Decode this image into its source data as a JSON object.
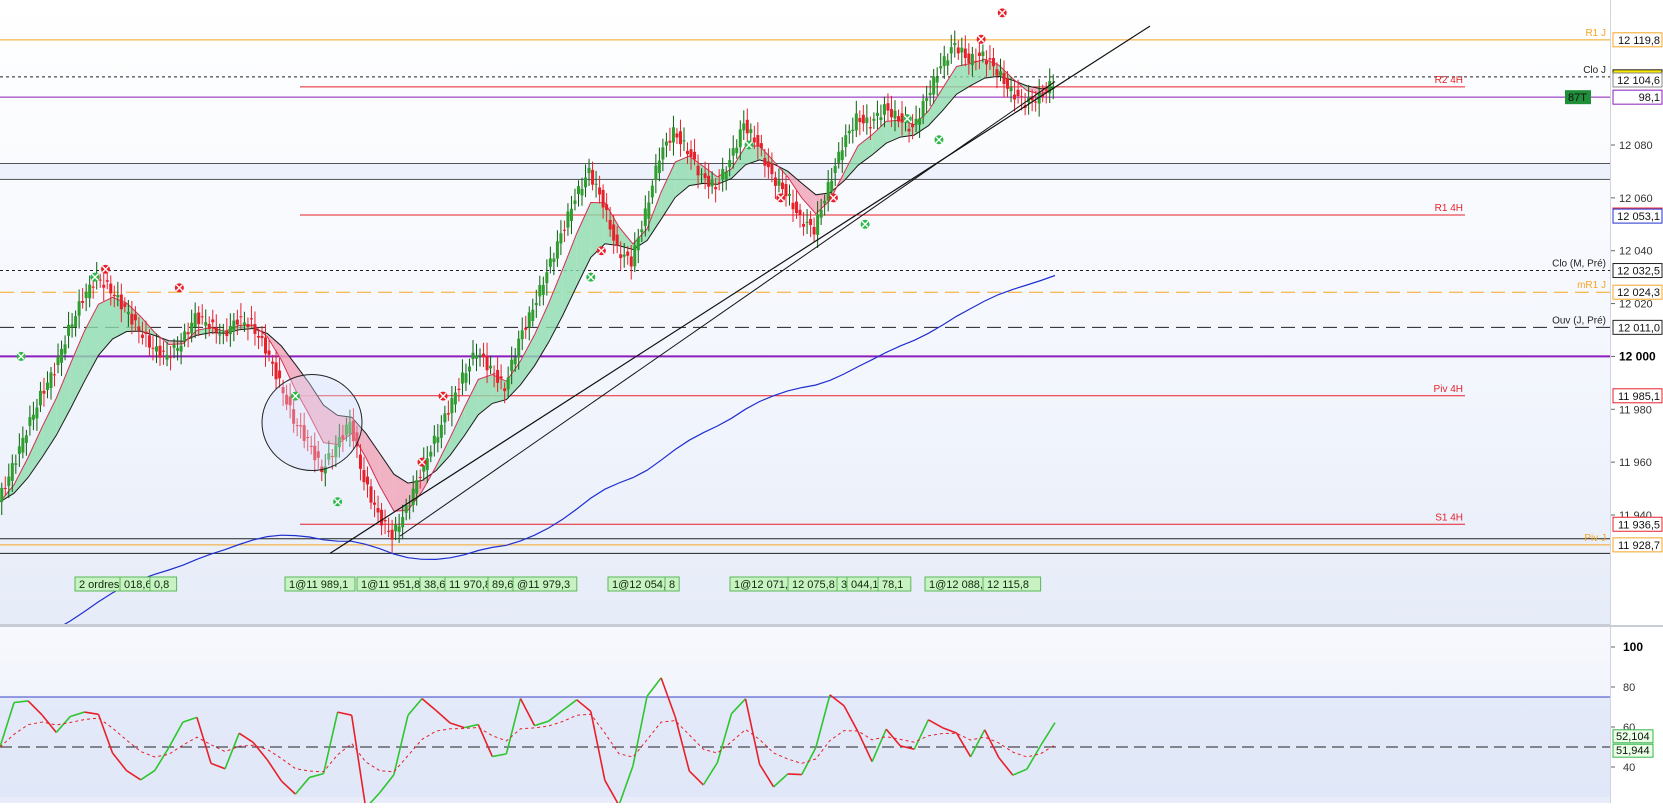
{
  "axis": {
    "main_ticks": [
      {
        "label": "12 080",
        "price": 12080
      },
      {
        "label": "12 060",
        "price": 12060
      },
      {
        "label": "12 040",
        "price": 12040
      },
      {
        "label": "12 020",
        "price": 12020
      },
      {
        "label": "12 000",
        "price": 12000,
        "bold": true
      },
      {
        "label": "11 980",
        "price": 11980
      },
      {
        "label": "11 960",
        "price": 11960
      },
      {
        "label": "11 940",
        "price": 11940
      }
    ],
    "osc_ticks": [
      {
        "label": "100",
        "value": 100,
        "bold": true
      },
      {
        "label": "80",
        "value": 80
      },
      {
        "label": "60",
        "value": 60
      },
      {
        "label": "40",
        "value": 40
      }
    ]
  },
  "levels": [
    {
      "label": "R1 J",
      "tag": "12 119,8",
      "price": 12119.8,
      "color": "#f5a623",
      "style": "solid"
    },
    {
      "label": "Clo J",
      "tag": "12 105,8",
      "price": 12105.8,
      "color": "#222222",
      "style": "dotted",
      "tag_bg": "#f7e600"
    },
    {
      "label": "",
      "tag": "12 104,6",
      "price": 12104.6,
      "color": "#888888",
      "style": "none"
    },
    {
      "label": "R2 4H",
      "tag": "",
      "price": 12102.0,
      "color": "#e8202a",
      "style": "solid"
    },
    {
      "label": "",
      "tag": "98,1",
      "price": 12098.1,
      "color": "#8a1dbb",
      "style": "solid",
      "prefix": "87T"
    },
    {
      "label": "",
      "tag": "",
      "price": 12073.0,
      "color": "#222222",
      "style": "solid"
    },
    {
      "label": "",
      "tag": "",
      "price": 12067.0,
      "color": "#222222",
      "style": "solid"
    },
    {
      "label": "R1 4H",
      "tag": "12 053,5",
      "price": 12053.5,
      "color": "#e8202a",
      "style": "solid"
    },
    {
      "label": "",
      "tag": "12 053,1",
      "price": 12053.1,
      "color": "#1f2fcf",
      "style": "none"
    },
    {
      "label": "Clo (M, Pré)",
      "tag": "12 032,5",
      "price": 12032.5,
      "color": "#222222",
      "style": "dotted"
    },
    {
      "label": "mR1 J",
      "tag": "12 024,3",
      "price": 12024.3,
      "color": "#f5a623",
      "style": "dashed"
    },
    {
      "label": "Ouv (J, Pré)",
      "tag": "12 011,0",
      "price": 12011.0,
      "color": "#222222",
      "style": "dashed"
    },
    {
      "label": "",
      "tag": "",
      "price": 12000.0,
      "color": "#8a1dbb",
      "style": "thick"
    },
    {
      "label": "Piv 4H",
      "tag": "11 985,1",
      "price": 11985.1,
      "color": "#e8202a",
      "style": "solid"
    },
    {
      "label": "S1 4H",
      "tag": "11 936,5",
      "price": 11936.5,
      "color": "#e8202a",
      "style": "solid"
    },
    {
      "label": "",
      "tag": "",
      "price": 11931.0,
      "color": "#222222",
      "style": "solid"
    },
    {
      "label": "Piv J",
      "tag": "11 928,7",
      "price": 11928.7,
      "color": "#f5a623",
      "style": "solid"
    },
    {
      "label": "",
      "tag": "",
      "price": 11925.5,
      "color": "#222222",
      "style": "solid"
    }
  ],
  "orders": [
    {
      "text": "2 ordres"
    },
    {
      "text": "018,6"
    },
    {
      "text": "0,8"
    },
    {
      "text": "1@11 989,1"
    },
    {
      "text": "1@11 951,8"
    },
    {
      "text": "38,6"
    },
    {
      "text": "11 970,8"
    },
    {
      "text": "89,6"
    },
    {
      "text": "@11 979,3"
    },
    {
      "text": "1@12 054,8"
    },
    {
      "text": "8"
    },
    {
      "text": "1@12 071,6"
    },
    {
      "text": "12 075,8"
    },
    {
      "text": "3"
    },
    {
      "text": "044,1"
    },
    {
      "text": "78,1"
    },
    {
      "text": "1@12 088,6"
    },
    {
      "text": "12 115,8"
    }
  ],
  "oscillator": {
    "tags": [
      {
        "text": "52,104",
        "value": 52.1
      },
      {
        "text": "51,944",
        "value": 51.9
      }
    ]
  },
  "colors": {
    "bull": "#2e9f2e",
    "bull_dark": "#0b5e0b",
    "bear": "#e8202a",
    "cloud_up": "#8fdcae",
    "cloud_down": "#f0a3b6",
    "ma_blue": "#1f2fcf",
    "trend": "#111111",
    "osc_up": "#2fc52f",
    "osc_down": "#e8202a"
  },
  "chart_data": {
    "type": "line",
    "series": [
      {
        "values": [
          11945,
          11958,
          11972,
          11985,
          11995,
          12010,
          12022,
          12030,
          12025,
          12018,
          12010,
          12003,
          12000,
          12005,
          12015,
          12012,
          12008,
          12014,
          12012,
          12003,
          11990,
          11976,
          11968,
          11957,
          11966,
          11975,
          11953,
          11940,
          11932,
          11942,
          11956,
          11968,
          11980,
          11992,
          12002,
          11995,
          11988,
          12006,
          12018,
          12032,
          12046,
          12060,
          12070,
          12058,
          12040,
          12036,
          12054,
          12076,
          12085,
          12078,
          12068,
          12064,
          12074,
          12088,
          12080,
          12068,
          12062,
          12052,
          12048,
          12064,
          12080,
          12090,
          12088,
          12094,
          12090,
          12086,
          12098,
          12110,
          12118,
          12112,
          12114,
          12108,
          12100,
          12096,
          12098,
          12104
        ]
      }
    ]
  }
}
